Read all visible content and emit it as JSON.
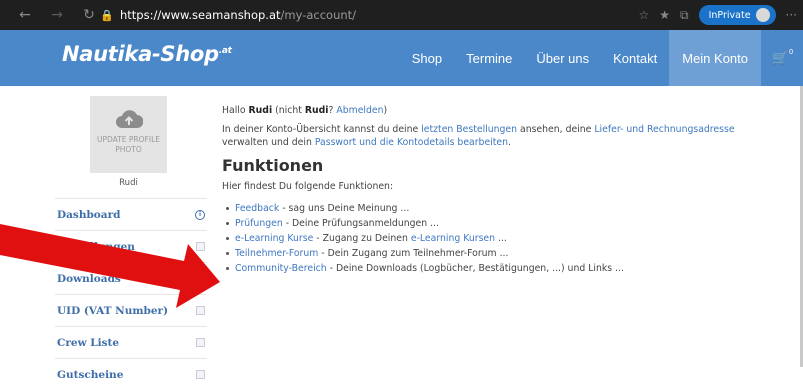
{
  "browser": {
    "url_host": "https://www.seamanshop.at",
    "url_path": "/my-account/",
    "inprivate_label": "InPrivate",
    "more_label": "···"
  },
  "header": {
    "logo_text": "Nautika-Shop",
    "logo_suffix": ".at",
    "nav": [
      {
        "label": "Shop"
      },
      {
        "label": "Termine"
      },
      {
        "label": "Über uns"
      },
      {
        "label": "Kontakt"
      },
      {
        "label": "Mein Konto"
      }
    ],
    "cart_count": "0",
    "accent_color": "#4b88c9"
  },
  "profile": {
    "upload_label_line1": "UPDATE PROFILE",
    "upload_label_line2": "PHOTO",
    "name": "Rudi"
  },
  "sidebar": {
    "items": [
      {
        "label": "Dashboard"
      },
      {
        "label": "Bestellungen"
      },
      {
        "label": "Downloads"
      },
      {
        "label": "UID (VAT Number)"
      },
      {
        "label": "Crew Liste"
      },
      {
        "label": "Gutscheine"
      }
    ]
  },
  "main": {
    "greeting": {
      "hello": "Hallo",
      "name": "Rudi",
      "not_prefix": "(nicht",
      "not_name": "Rudi",
      "logout_prefix": "?",
      "logout_link": "Abmelden",
      "close": ")"
    },
    "overview": {
      "t1": "In deiner Konto-Übersicht kannst du deine",
      "link1": "letzten Bestellungen",
      "t2": "ansehen, deine",
      "link2": "Liefer- und Rechnungsadresse",
      "t3": "verwalten und dein",
      "link3": "Passwort und die Kontodetails bearbeiten",
      "t4": "."
    },
    "heading": "Funktionen",
    "intro": "Hier findest Du folgende Funktionen:",
    "functions": [
      {
        "link": "Feedback",
        "text": " - sag uns Deine Meinung ..."
      },
      {
        "link": "Prüfungen",
        "text": " - Deine Prüfungsanmeldungen ..."
      },
      {
        "link": "e-Learning Kurse",
        "text": " - Zugang zu Deinen ",
        "link2": "e-Learning Kursen",
        "text2": " ..."
      },
      {
        "link": "Teilnehmer-Forum",
        "text": " - Dein Zugang zum Teilnehmer-Forum ..."
      },
      {
        "link": "Community-Bereich",
        "text": " - Deine Downloads (Logbücher, Bestätigungen, ...) und Links ..."
      }
    ]
  },
  "annotation": {
    "arrow_color": "#e01010"
  }
}
